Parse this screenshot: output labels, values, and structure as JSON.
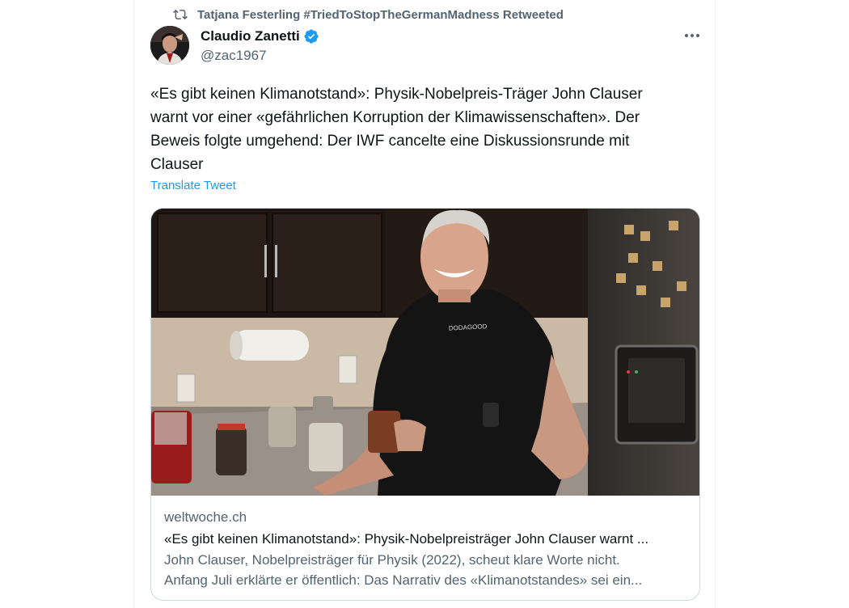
{
  "retweet": {
    "icon": "retweet-icon",
    "text": "Tatjana Festerling #TriedToStopTheGermanMadness Retweeted"
  },
  "author": {
    "name": "Claudio Zanetti",
    "handle": "@zac1967",
    "verified": true,
    "avatar_icon": "avatar"
  },
  "tweet": {
    "text": "«Es gibt keinen Klimanotstand»: Physik-Nobelpreis-Träger John Clauser\nwarnt vor einer «gefährlichen Korruption der Klimawissenschaften». Der\nBeweis folgte umgehend: Der IWF cancelte eine Diskussionsrunde mit\nClauser",
    "translate_label": "Translate Tweet"
  },
  "card": {
    "domain": "weltwoche.ch",
    "title": "«Es gibt keinen Klimanotstand»: Physik-Nobelpreisträger John Clauser warnt ...",
    "description_line1": "John Clauser, Nobelpreisträger für Physik (2022), scheut klare Worte nicht.",
    "description_line2": "Anfang Juli erklärte er öffentlich: Das Narrativ des «Klimanotstandes» sei ein...",
    "shirt_logo_text": "DODAGOOD"
  },
  "colors": {
    "link": "#1d9bf0",
    "secondary_text": "#536471",
    "primary_text": "#0f1419",
    "border": "#cfd9de"
  }
}
